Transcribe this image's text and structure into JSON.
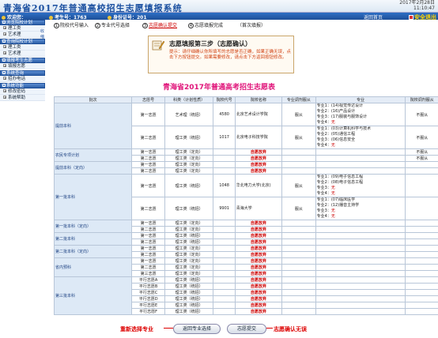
{
  "header": {
    "title": "青海省2017年普通高校招生志愿填报系统",
    "date": "2017年2月28日",
    "time": "11:10:47"
  },
  "infobar": {
    "welcome": "欢迎您：",
    "exam_no_label": "考生号：1763",
    "cert_label": "身份证号：201",
    "home": "返回首页",
    "exit": "安全退出"
  },
  "sidebar": {
    "collapse": "收缩",
    "groups": [
      {
        "title": "浏览院校计划",
        "items": [
          "理工类",
          "艺术理"
        ]
      },
      {
        "title": "查询院校计划",
        "items": [
          "理工类",
          "艺术理"
        ]
      },
      {
        "title": "填报考生志愿",
        "items": [
          "填报志愿"
        ]
      },
      {
        "title": "系统查询",
        "items": [
          "招办电话"
        ]
      },
      {
        "title": "系统功能",
        "items": [
          "修改密码",
          "系统帮助"
        ]
      }
    ]
  },
  "steps": [
    {
      "num": "1",
      "label": "院校代号输入"
    },
    {
      "num": "2",
      "label": "专业代号选择"
    },
    {
      "num": "3",
      "label": "志愿确认提交"
    },
    {
      "num": "4",
      "label": "志愿填报完成"
    },
    {
      "num": "",
      "label": "（首次填报）"
    }
  ],
  "notice": {
    "title": "志愿填报第三步（志愿确认）",
    "body": "提示：请仔细确认你所填写的志愿是否正确，如果正确无误，点击下方按钮提交。如果需要修改，请点击下方返回按钮修改。"
  },
  "table_title": "青海省2017年普通高考招生志愿表",
  "table": {
    "headers": [
      "批次",
      "志愿号",
      "科类（计划性质）",
      "院校代号",
      "院校名称",
      "专业调剂服从",
      "专业",
      "院校调剂服从"
    ],
    "empty_text": "自愿放弃",
    "rows": [
      {
        "batch": "提前本科",
        "wish": "第一志愿",
        "type": "艺术理（统招）",
        "code": "4580",
        "school": "北京艺术设计学院",
        "adjust": "服从",
        "majors": [
          "专业1：(14)视觉传达设计",
          "专业2：(16)产品设计",
          "专业3：(17)服装与服饰设计",
          "专业4：无"
        ],
        "school_adjust": "不服从"
      },
      {
        "batch": "",
        "wish": "第二志愿",
        "type": "理工类（统招）",
        "code": "1017",
        "school": "北京电子科技学院",
        "adjust": "服从",
        "majors": [
          "专业1：(03)计算机科学与技术",
          "专业2：(05)通信工程",
          "专业3：(06)信息安全",
          "专业4：无"
        ],
        "school_adjust": "不服从"
      },
      {
        "batch": "农民专项计划",
        "wish": "第一志愿",
        "type": "理工类（定向）",
        "empty": true,
        "school_adjust": "不服从"
      },
      {
        "batch": "",
        "wish": "第二志愿",
        "type": "理工类（定向）",
        "empty": true,
        "school_adjust": "不服从"
      },
      {
        "batch": "提前本科（定向）",
        "wish": "第一志愿",
        "type": "理工类（定向）",
        "empty": true
      },
      {
        "batch": "",
        "wish": "第二志愿",
        "type": "理工类（定向）",
        "empty": true
      },
      {
        "batch": "第一批本科",
        "wish": "第一志愿",
        "type": "理工类（统招）",
        "code": "1048",
        "school": "华北电力大学(北京)",
        "adjust": "服从",
        "majors": [
          "专业1：(09)电子信息工程",
          "专业2：(08)电子信息工程",
          "专业3：无",
          "专业4：无"
        ],
        "school_adjust": ""
      },
      {
        "batch": "",
        "wish": "第二志愿",
        "type": "理工类（统招）",
        "code": "9901",
        "school": "青海大学",
        "adjust": "服从",
        "majors": [
          "专业1：(07)临床医学",
          "专业2：(12)播音主持学",
          "专业3：无",
          "专业4：无"
        ],
        "school_adjust": ""
      },
      {
        "batch": "第一批本科（定向）",
        "wish": "第一志愿",
        "type": "理工类（定向）",
        "empty": true
      },
      {
        "batch": "",
        "wish": "第二志愿",
        "type": "理工类（定向）",
        "empty": true
      },
      {
        "batch": "第二批本科",
        "wish": "第一志愿",
        "type": "理工类（统招）",
        "empty": true
      },
      {
        "batch": "",
        "wish": "第二志愿",
        "type": "理工类（统招）",
        "empty": true
      },
      {
        "batch": "第二批本科（定向）",
        "wish": "第一志愿",
        "type": "理工类（定向）",
        "empty": true
      },
      {
        "batch": "",
        "wish": "第二志愿",
        "type": "理工类（定向）",
        "empty": true
      },
      {
        "batch": "省内预科",
        "wish": "第一志愿",
        "type": "理工类（定向）",
        "empty": true
      },
      {
        "batch": "",
        "wish": "第二志愿",
        "type": "理工类（定向）",
        "empty": true
      },
      {
        "batch": "",
        "wish": "第三志愿",
        "type": "理工类（定向）",
        "empty": true
      },
      {
        "batch": "第三批本科",
        "wish": "平行志愿A",
        "type": "理工类（统招）",
        "empty": true
      },
      {
        "batch": "",
        "wish": "平行志愿B",
        "type": "理工类（统招）",
        "empty": true
      },
      {
        "batch": "",
        "wish": "平行志愿C",
        "type": "理工类（统招）",
        "empty": true
      },
      {
        "batch": "",
        "wish": "平行志愿D",
        "type": "理工类（统招）",
        "empty": true
      },
      {
        "batch": "",
        "wish": "平行志愿E",
        "type": "理工类（统招）",
        "empty": true
      },
      {
        "batch": "",
        "wish": "平行志愿F",
        "type": "理工类（统招）",
        "empty": true
      }
    ]
  },
  "bottom": {
    "left_tag": "重新选择专业",
    "back_button": "返回专业选择",
    "submit_button": "志愿提交",
    "right_tag": "志愿确认无误"
  },
  "colors": {
    "accent": "#1e4f98",
    "alert": "#dd0000",
    "title_pink": "#e0147a"
  }
}
